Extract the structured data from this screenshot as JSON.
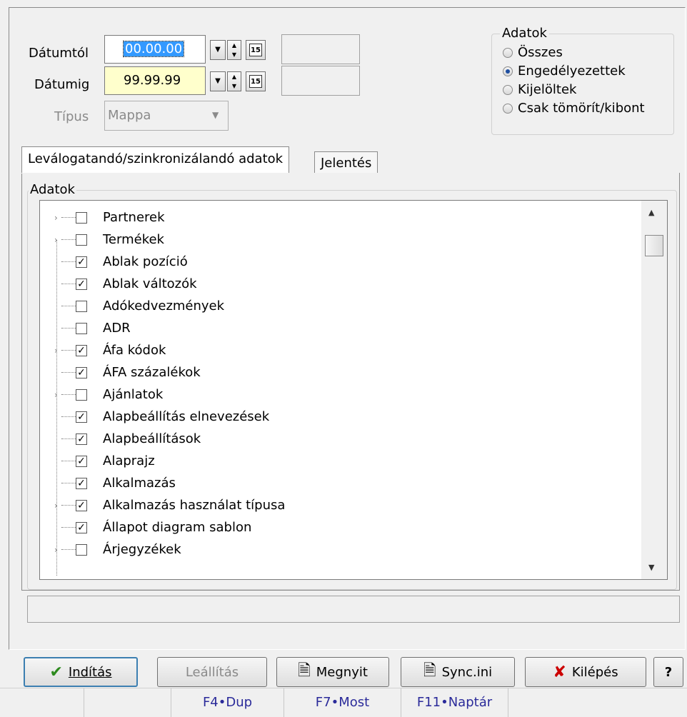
{
  "filters": {
    "date_from_label": "Dátumtól",
    "date_from_value": "00.00.00",
    "date_to_label": "Dátumig",
    "date_to_value": "99.99.99",
    "type_label": "Típus",
    "type_value": "Mappa",
    "calendar_glyph": "15"
  },
  "adatok_group": {
    "title": "Adatok",
    "options": [
      {
        "label": "Összes",
        "selected": false
      },
      {
        "label": "Engedélyezettek",
        "selected": true
      },
      {
        "label": "Kijelöltek",
        "selected": false
      },
      {
        "label": "Csak tömörít/kibont",
        "selected": false
      }
    ]
  },
  "tabs": [
    {
      "label": "Leválogatandó/szinkronizálandó adatok",
      "active": true
    },
    {
      "label": "Jelentés",
      "active": false
    }
  ],
  "tree_group_title": "Adatok",
  "tree_items": [
    {
      "label": "Partnerek",
      "checked": false,
      "expandable": true
    },
    {
      "label": "Termékek",
      "checked": false,
      "expandable": true
    },
    {
      "label": "Ablak pozíció",
      "checked": true,
      "expandable": false
    },
    {
      "label": "Ablak változók",
      "checked": true,
      "expandable": false
    },
    {
      "label": "Adókedvezmények",
      "checked": false,
      "expandable": false
    },
    {
      "label": "ADR",
      "checked": false,
      "expandable": false
    },
    {
      "label": "Áfa kódok",
      "checked": true,
      "expandable": true
    },
    {
      "label": "ÁFA százalékok",
      "checked": true,
      "expandable": false
    },
    {
      "label": "Ajánlatok",
      "checked": false,
      "expandable": true
    },
    {
      "label": "Alapbeállítás elnevezések",
      "checked": true,
      "expandable": false
    },
    {
      "label": "Alapbeállítások",
      "checked": true,
      "expandable": false
    },
    {
      "label": "Alaprajz",
      "checked": true,
      "expandable": false
    },
    {
      "label": "Alkalmazás",
      "checked": true,
      "expandable": false
    },
    {
      "label": "Alkalmazás használat típusa",
      "checked": true,
      "expandable": true
    },
    {
      "label": "Állapot diagram sablon",
      "checked": true,
      "expandable": false
    },
    {
      "label": "Árjegyzékek",
      "checked": false,
      "expandable": true
    }
  ],
  "buttons": {
    "start": "Indítás",
    "stop": "Leállítás",
    "open": "Megnyit",
    "sync": "Sync.ini",
    "exit": "Kilépés",
    "help": "?"
  },
  "statusbar": [
    "",
    "",
    "F4•Dup",
    "F7•Most",
    "F11•Naptár",
    ""
  ]
}
